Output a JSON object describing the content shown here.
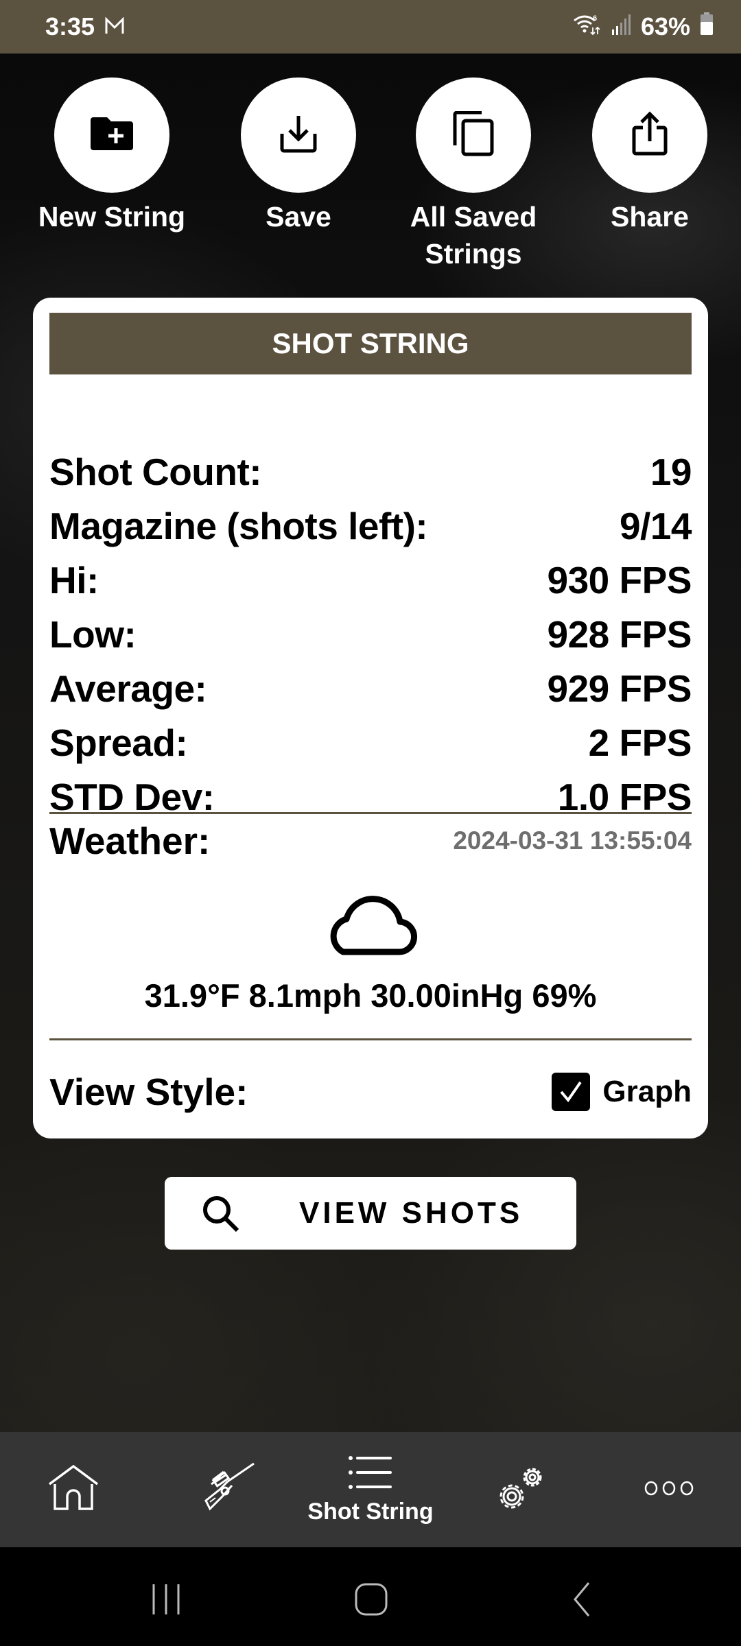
{
  "status_bar": {
    "time": "3:35",
    "notification_icon": "gmail-icon",
    "battery_percent": "63%",
    "icons": [
      "wifi-icon",
      "signal-icon",
      "battery-icon"
    ]
  },
  "actions": [
    {
      "label": "New String",
      "icon": "new-folder-icon"
    },
    {
      "label": "Save",
      "icon": "download-icon"
    },
    {
      "label": "All Saved Strings",
      "icon": "copy-icon"
    },
    {
      "label": "Share",
      "icon": "share-icon"
    }
  ],
  "card": {
    "title": "SHOT STRING",
    "stats": [
      {
        "label": "Shot Count:",
        "value": "19"
      },
      {
        "label": "Magazine (shots left):",
        "value": "9/14"
      },
      {
        "label": "Hi:",
        "value": "930 FPS"
      },
      {
        "label": "Low:",
        "value": "928 FPS"
      },
      {
        "label": "Average:",
        "value": "929 FPS"
      },
      {
        "label": "Spread:",
        "value": "2 FPS"
      },
      {
        "label": "STD Dev:",
        "value": "1.0 FPS"
      }
    ],
    "weather": {
      "label": "Weather:",
      "timestamp": "2024-03-31 13:55:04",
      "icon": "cloud-icon",
      "summary": "31.9°F 8.1mph 30.00inHg 69%"
    },
    "view_style": {
      "label": "View Style:",
      "option_label": "Graph",
      "checked": true
    }
  },
  "view_shots_button": {
    "label": "VIEW SHOTS",
    "icon": "search-icon"
  },
  "bottom_nav": [
    {
      "icon": "home-icon",
      "label": ""
    },
    {
      "icon": "rifle-icon",
      "label": ""
    },
    {
      "icon": "list-icon",
      "label": "Shot String",
      "active": true
    },
    {
      "icon": "gears-icon",
      "label": ""
    },
    {
      "icon": "more-icon",
      "label": ""
    }
  ],
  "system_nav": [
    "recents-button",
    "home-button",
    "back-button"
  ],
  "colors": {
    "brand": "#5c5240",
    "nav_bg": "#353535",
    "timestamp": "#6e6e6e"
  }
}
